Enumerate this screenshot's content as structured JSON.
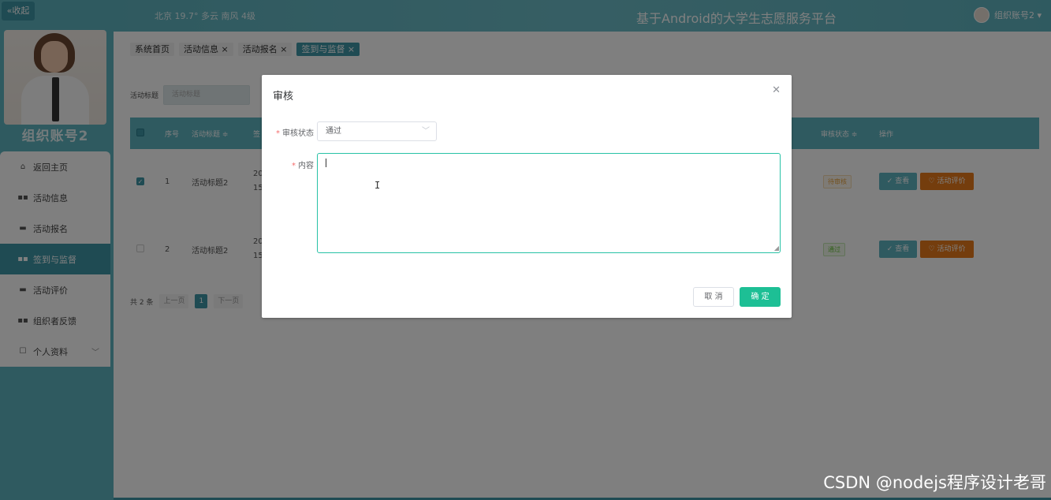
{
  "sidebar": {
    "collapse_label": "«收起",
    "user_name": "组织账号2",
    "items": [
      {
        "label": "返回主页",
        "icon": "home-icon"
      },
      {
        "label": "活动信息",
        "icon": "grid-icon"
      },
      {
        "label": "活动报名",
        "icon": "briefcase-icon"
      },
      {
        "label": "签到与监督",
        "icon": "grid-icon",
        "active": true
      },
      {
        "label": "活动评价",
        "icon": "comment-icon"
      },
      {
        "label": "组织者反馈",
        "icon": "grid-icon"
      },
      {
        "label": "个人资料",
        "icon": "profile-icon"
      }
    ]
  },
  "header": {
    "weather": "北京  19.7°  多云  南风  4级",
    "title": "基于Android的大学生志愿服务平台",
    "user": "组织账号2 ▾"
  },
  "tabs": [
    {
      "label": "系统首页"
    },
    {
      "label": "活动信息 ×"
    },
    {
      "label": "活动报名 ×"
    },
    {
      "label": "签到与监督 ×",
      "active": true
    }
  ],
  "search": {
    "label": "活动标题",
    "placeholder": "活动标题"
  },
  "table": {
    "headers": [
      "序号",
      "活动标题 ≑",
      "签",
      "审核状态 ≑",
      "操作"
    ],
    "rows": [
      {
        "index": "1",
        "title": "活动标题2",
        "date_a": "20",
        "date_b": "15",
        "status": "待审核",
        "checked": true
      },
      {
        "index": "2",
        "title": "活动标题2",
        "date_a": "20",
        "date_b": "15",
        "status": "通过",
        "checked": false
      }
    ],
    "view_label": "✓ 查看",
    "eval_label": "♡ 活动评价"
  },
  "pager": {
    "total": "共 2 条",
    "prev": "上一页",
    "current": "1",
    "next": "下一页"
  },
  "dialog": {
    "title": "审核",
    "status_label": "审核状态",
    "status_value": "通过",
    "content_label": "内容",
    "cancel": "取 消",
    "ok": "确 定"
  },
  "watermark": "CSDN @nodejs程序设计老哥",
  "colors": {
    "sidebar": "#5fb4c0",
    "accent": "#3f96a6",
    "primary_button": "#1dbf95",
    "textarea_focus": "#28c2a6",
    "eval_button": "#e87b1a"
  }
}
